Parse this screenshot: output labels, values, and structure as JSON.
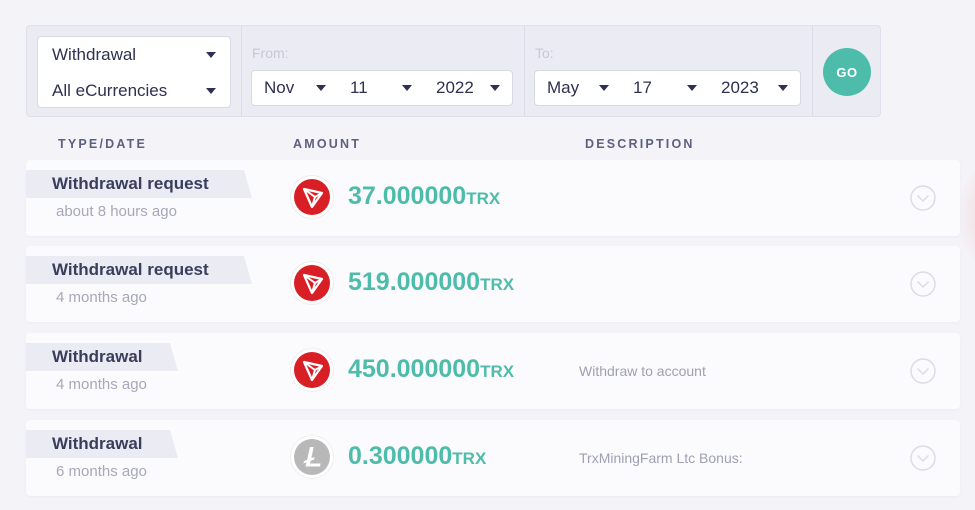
{
  "filters": {
    "type_select": {
      "value": "Withdrawal"
    },
    "currency_select": {
      "value": "All eCurrencies"
    },
    "from": {
      "label": "From:",
      "month": "Nov",
      "day": "11",
      "year": "2022"
    },
    "to": {
      "label": "To:",
      "month": "May",
      "day": "17",
      "year": "2023"
    },
    "go_label": "GO"
  },
  "columns": {
    "type_date": "TYPE/DATE",
    "amount": "AMOUNT",
    "description": "DESCRIPTION"
  },
  "rows": [
    {
      "type": "Withdrawal request",
      "time": "about 8 hours ago",
      "coin_icon": "tron-icon",
      "amount": "37.000000",
      "currency": "TRX",
      "description": ""
    },
    {
      "type": "Withdrawal request",
      "time": "4 months ago",
      "coin_icon": "tron-icon",
      "amount": "519.000000",
      "currency": "TRX",
      "description": ""
    },
    {
      "type": "Withdrawal",
      "time": "4 months ago",
      "coin_icon": "tron-icon",
      "amount": "450.000000",
      "currency": "TRX",
      "description": "Withdraw to account"
    },
    {
      "type": "Withdrawal",
      "time": "6 months ago",
      "coin_icon": "litecoin-icon",
      "amount": "0.300000",
      "currency": "TRX",
      "description": "TrxMiningFarm Ltc Bonus:"
    }
  ],
  "colors": {
    "accent": "#4dbcaa",
    "tron": "#d91f26",
    "litecoin": "#b8b8b8"
  }
}
